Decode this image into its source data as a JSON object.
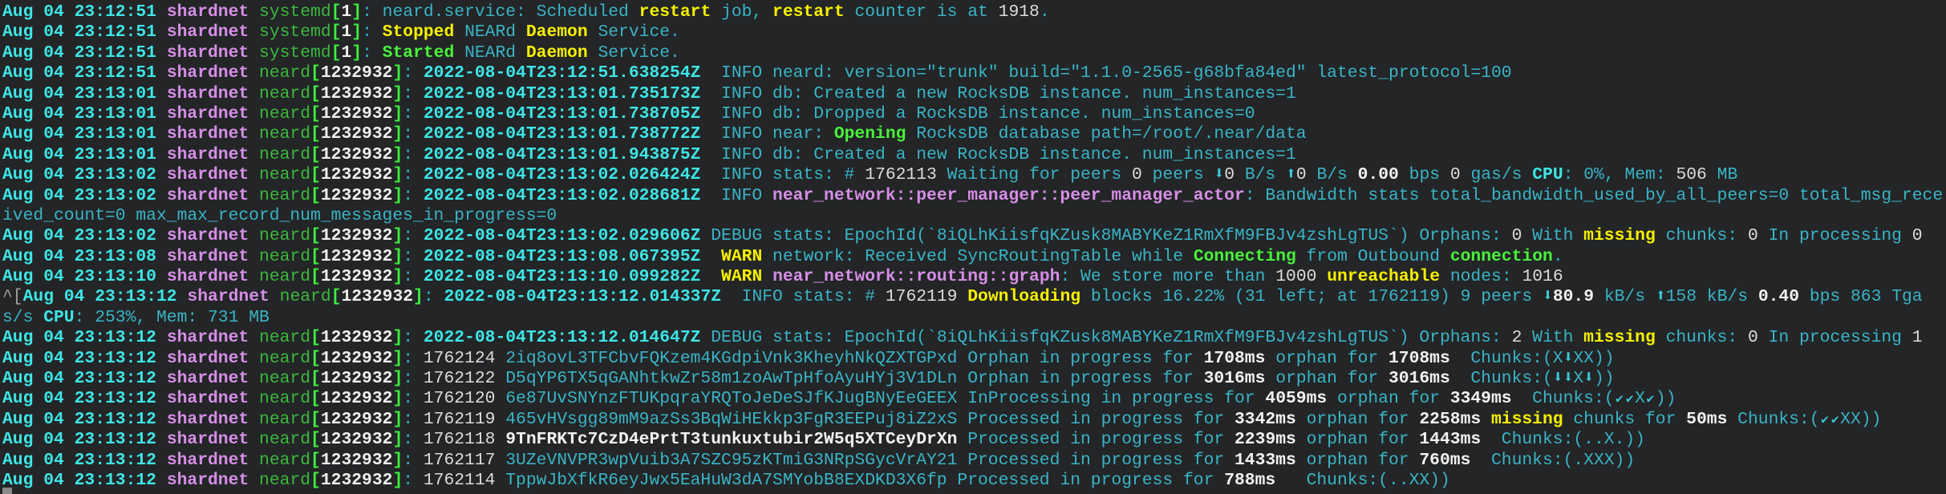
{
  "colors": {
    "background": "#232527",
    "timestamp": "#3ee6e6",
    "host": "#d68ee6",
    "text": "#3ab4c6",
    "highlight": "#f6f000",
    "success": "#4af23a"
  },
  "lines": [
    {
      "time": "Aug 04 23:12:51",
      "host": "shardnet",
      "proc": "systemd",
      "pid": "1",
      "segs": [
        [
          "neard.service: Scheduled ",
          "t"
        ],
        [
          "restart",
          "y"
        ],
        [
          " job, ",
          "t"
        ],
        [
          "restart",
          "y"
        ],
        [
          " counter is at ",
          "t"
        ],
        [
          "1918",
          "w"
        ],
        [
          ".",
          "t"
        ]
      ]
    },
    {
      "time": "Aug 04 23:12:51",
      "host": "shardnet",
      "proc": "systemd",
      "pid": "1",
      "segs": [
        [
          "Stopped",
          "y"
        ],
        [
          " NEARd ",
          "t"
        ],
        [
          "Daemon",
          "y"
        ],
        [
          " Service.",
          "t"
        ]
      ]
    },
    {
      "time": "Aug 04 23:12:51",
      "host": "shardnet",
      "proc": "systemd",
      "pid": "1",
      "segs": [
        [
          "Started",
          "g"
        ],
        [
          " NEARd ",
          "t"
        ],
        [
          "Daemon",
          "y"
        ],
        [
          " Service.",
          "t"
        ]
      ]
    },
    {
      "time": "Aug 04 23:12:51",
      "host": "shardnet",
      "proc": "neard",
      "pid": "1232932",
      "segs": [
        [
          "2022-08-04T23:12:51.638254Z",
          "c"
        ],
        [
          "  INFO neard: version=\"trunk\" build=\"1.1.0-2565-g68bfa84ed\" latest_protocol=100",
          "t"
        ]
      ]
    },
    {
      "time": "Aug 04 23:13:01",
      "host": "shardnet",
      "proc": "neard",
      "pid": "1232932",
      "segs": [
        [
          "2022-08-04T23:13:01.735173Z",
          "c"
        ],
        [
          "  INFO db: Created a new RocksDB instance. num_instances=1",
          "t"
        ]
      ]
    },
    {
      "time": "Aug 04 23:13:01",
      "host": "shardnet",
      "proc": "neard",
      "pid": "1232932",
      "segs": [
        [
          "2022-08-04T23:13:01.738705Z",
          "c"
        ],
        [
          "  INFO db: Dropped a RocksDB instance. num_instances=0",
          "t"
        ]
      ]
    },
    {
      "time": "Aug 04 23:13:01",
      "host": "shardnet",
      "proc": "neard",
      "pid": "1232932",
      "segs": [
        [
          "2022-08-04T23:13:01.738772Z",
          "c"
        ],
        [
          "  INFO near: ",
          "t"
        ],
        [
          "Opening",
          "g"
        ],
        [
          " RocksDB database path=/root/.near/data",
          "t"
        ]
      ]
    },
    {
      "time": "Aug 04 23:13:01",
      "host": "shardnet",
      "proc": "neard",
      "pid": "1232932",
      "segs": [
        [
          "2022-08-04T23:13:01.943875Z",
          "c"
        ],
        [
          "  INFO db: Created a new RocksDB instance. num_instances=1",
          "t"
        ]
      ]
    },
    {
      "time": "Aug 04 23:13:02",
      "host": "shardnet",
      "proc": "neard",
      "pid": "1232932",
      "segs": [
        [
          "2022-08-04T23:13:02.026424Z",
          "c"
        ],
        [
          "  INFO stats: # ",
          "t"
        ],
        [
          "1762113",
          "w"
        ],
        [
          " Waiting for peers ",
          "t"
        ],
        [
          "0",
          "w"
        ],
        [
          " peers ",
          "t"
        ],
        [
          "⬇",
          "a"
        ],
        [
          "0",
          "w"
        ],
        [
          " B/s ",
          "t"
        ],
        [
          "⬆",
          "a"
        ],
        [
          "0",
          "w"
        ],
        [
          " B/s ",
          "t"
        ],
        [
          "0.00",
          "W"
        ],
        [
          " bps ",
          "t"
        ],
        [
          "0",
          "w"
        ],
        [
          " gas/s ",
          "t"
        ],
        [
          "CPU",
          "c"
        ],
        [
          ": 0%, Mem: ",
          "t"
        ],
        [
          "506",
          "w"
        ],
        [
          " MB",
          "t"
        ]
      ]
    },
    {
      "time": "Aug 04 23:13:02",
      "host": "shardnet",
      "proc": "neard",
      "pid": "1232932",
      "segs": [
        [
          "2022-08-04T23:13:02.028681Z",
          "c"
        ],
        [
          "  INFO ",
          "t"
        ],
        [
          "near_network::peer_manager::peer_manager_actor",
          "v"
        ],
        [
          ": Bandwidth stats total_bandwidth_used_by_all_peers=0 total_msg_rece",
          "t"
        ]
      ]
    },
    {
      "segs": [
        [
          "ived_count=0 max_max_record_num_messages_in_progress=0",
          "t"
        ]
      ]
    },
    {
      "time": "Aug 04 23:13:02",
      "host": "shardnet",
      "proc": "neard",
      "pid": "1232932",
      "segs": [
        [
          "2022-08-04T23:13:02.029606Z",
          "c"
        ],
        [
          " DEBUG stats: EpochId(`8iQLhKiisfqKZusk8MABYKeZ1RmXfM9FBJv4zshLgTUS`) Orphans: ",
          "t"
        ],
        [
          "0",
          "w"
        ],
        [
          " With ",
          "t"
        ],
        [
          "missing",
          "y"
        ],
        [
          " chunks: ",
          "t"
        ],
        [
          "0",
          "w"
        ],
        [
          " In processing ",
          "t"
        ],
        [
          "0",
          "w"
        ]
      ]
    },
    {
      "time": "Aug 04 23:13:08",
      "host": "shardnet",
      "proc": "neard",
      "pid": "1232932",
      "segs": [
        [
          "2022-08-04T23:13:08.067395Z",
          "c"
        ],
        [
          "  ",
          "t"
        ],
        [
          "WARN",
          "y"
        ],
        [
          " network: Received SyncRoutingTable while ",
          "t"
        ],
        [
          "Connecting",
          "g"
        ],
        [
          " from Outbound ",
          "t"
        ],
        [
          "connection",
          "g"
        ],
        [
          ".",
          "t"
        ]
      ]
    },
    {
      "time": "Aug 04 23:13:10",
      "host": "shardnet",
      "proc": "neard",
      "pid": "1232932",
      "segs": [
        [
          "2022-08-04T23:13:10.099282Z",
          "c"
        ],
        [
          "  ",
          "t"
        ],
        [
          "WARN",
          "y"
        ],
        [
          " ",
          "t"
        ],
        [
          "near_network::routing::graph",
          "v"
        ],
        [
          ": We store more than ",
          "t"
        ],
        [
          "1000",
          "w"
        ],
        [
          " ",
          "t"
        ],
        [
          "unreachable",
          "y"
        ],
        [
          " nodes: ",
          "t"
        ],
        [
          "1016",
          "w"
        ]
      ]
    },
    {
      "esc": "^[",
      "time": "Aug 04 23:13:12",
      "host": "shardnet",
      "proc": "neard",
      "pid": "1232932",
      "segs": [
        [
          "2022-08-04T23:13:12.014337Z",
          "c"
        ],
        [
          "  INFO stats: # ",
          "t"
        ],
        [
          "1762119",
          "w"
        ],
        [
          " ",
          "t"
        ],
        [
          "Downloading",
          "y"
        ],
        [
          " blocks 16.22% (31 left; at 1762119) 9 peers ",
          "t"
        ],
        [
          "⬇",
          "a"
        ],
        [
          "80.9",
          "W"
        ],
        [
          " kB/s ",
          "t"
        ],
        [
          "⬆",
          "a"
        ],
        [
          "158 kB/s ",
          "t"
        ],
        [
          "0.40",
          "W"
        ],
        [
          " bps 863 Tga",
          "t"
        ]
      ]
    },
    {
      "segs": [
        [
          "s/s ",
          "t"
        ],
        [
          "CPU",
          "c"
        ],
        [
          ": 253%, Mem: 731 MB",
          "t"
        ]
      ]
    },
    {
      "time": "Aug 04 23:13:12",
      "host": "shardnet",
      "proc": "neard",
      "pid": "1232932",
      "segs": [
        [
          "2022-08-04T23:13:12.014647Z",
          "c"
        ],
        [
          " DEBUG stats: EpochId(`8iQLhKiisfqKZusk8MABYKeZ1RmXfM9FBJv4zshLgTUS`) Orphans: ",
          "t"
        ],
        [
          "2",
          "w"
        ],
        [
          " With ",
          "t"
        ],
        [
          "missing",
          "y"
        ],
        [
          " chunks: ",
          "t"
        ],
        [
          "0",
          "w"
        ],
        [
          " In processing ",
          "t"
        ],
        [
          "1",
          "w"
        ]
      ]
    },
    {
      "time": "Aug 04 23:13:12",
      "host": "shardnet",
      "proc": "neard",
      "pid": "1232932",
      "segs": [
        [
          "1762124",
          "w"
        ],
        [
          " 2iq8ovL3TFCbvFQKzem4KGdpiVnk3KheyhNkQZXTGPxd Orphan in progress for ",
          "t"
        ],
        [
          "1708ms",
          "W"
        ],
        [
          " orphan for ",
          "t"
        ],
        [
          "1708ms",
          "W"
        ],
        [
          "  Chunks:(X",
          "t"
        ],
        [
          "⬇",
          "a"
        ],
        [
          "XX))",
          "t"
        ]
      ]
    },
    {
      "time": "Aug 04 23:13:12",
      "host": "shardnet",
      "proc": "neard",
      "pid": "1232932",
      "segs": [
        [
          "1762122",
          "w"
        ],
        [
          " D5qYP6TX5qGANhtkwZr58m1zoAwTpHfoAyuHYj3V1DLn Orphan in progress for ",
          "t"
        ],
        [
          "3016ms",
          "W"
        ],
        [
          " orphan for ",
          "t"
        ],
        [
          "3016ms",
          "W"
        ],
        [
          "  Chunks:(",
          "t"
        ],
        [
          "⬇",
          "a"
        ],
        [
          "⬇",
          "a"
        ],
        [
          "X",
          "t"
        ],
        [
          "⬇",
          "a"
        ],
        [
          "))",
          "t"
        ]
      ]
    },
    {
      "time": "Aug 04 23:13:12",
      "host": "shardnet",
      "proc": "neard",
      "pid": "1232932",
      "segs": [
        [
          "1762120",
          "w"
        ],
        [
          " 6e87UvSNYnzFTUKpqraYRQToJeDeSJfKJugBNyEeGEEX InProcessing in progress for ",
          "t"
        ],
        [
          "4059ms",
          "W"
        ],
        [
          " orphan for ",
          "t"
        ],
        [
          "3349ms",
          "W"
        ],
        [
          "  Chunks:(",
          "t"
        ],
        [
          "✔",
          "ck"
        ],
        [
          "✔",
          "ck"
        ],
        [
          "X",
          "t"
        ],
        [
          "✔",
          "ck"
        ],
        [
          "))",
          "t"
        ]
      ]
    },
    {
      "time": "Aug 04 23:13:12",
      "host": "shardnet",
      "proc": "neard",
      "pid": "1232932",
      "segs": [
        [
          "1762119",
          "w"
        ],
        [
          " 465vHVsgg89mM9azSs3BqWiHEkkp3FgR3EEPuj8iZ2xS Processed in progress for ",
          "t"
        ],
        [
          "3342ms",
          "W"
        ],
        [
          " orphan for ",
          "t"
        ],
        [
          "2258ms",
          "W"
        ],
        [
          " ",
          "t"
        ],
        [
          "missing",
          "y"
        ],
        [
          " chunks for ",
          "t"
        ],
        [
          "50ms",
          "W"
        ],
        [
          " Chunks:(",
          "t"
        ],
        [
          "✔",
          "ck"
        ],
        [
          "✔",
          "ck"
        ],
        [
          "XX))",
          "t"
        ]
      ]
    },
    {
      "time": "Aug 04 23:13:12",
      "host": "shardnet",
      "proc": "neard",
      "pid": "1232932",
      "segs": [
        [
          "1762118",
          "w"
        ],
        [
          " ",
          "t"
        ],
        [
          "9TnFRKTc7CzD4ePrtT3tunkuxtubir2W5q5XTCeyDrXn",
          "W"
        ],
        [
          " Processed in progress for ",
          "t"
        ],
        [
          "2239ms",
          "W"
        ],
        [
          " orphan for ",
          "t"
        ],
        [
          "1443ms",
          "W"
        ],
        [
          "  Chunks:(..X.))",
          "t"
        ]
      ]
    },
    {
      "time": "Aug 04 23:13:12",
      "host": "shardnet",
      "proc": "neard",
      "pid": "1232932",
      "segs": [
        [
          "1762117",
          "w"
        ],
        [
          " 3UZeVNVPR3wpVuib3A7SZC95zKTmiG3NRpSGycVrAY21 Processed in progress for ",
          "t"
        ],
        [
          "1433ms",
          "W"
        ],
        [
          " orphan for ",
          "t"
        ],
        [
          "760ms",
          "W"
        ],
        [
          "  Chunks:(.XXX))",
          "t"
        ]
      ]
    },
    {
      "time": "Aug 04 23:13:12",
      "host": "shardnet",
      "proc": "neard",
      "pid": "1232932",
      "segs": [
        [
          "1762114",
          "w"
        ],
        [
          " TppwJbXfkR6eyJwx5EaHuW3dA7SMYobB8EXDKD3X6fp Processed in progress for ",
          "t"
        ],
        [
          "788ms",
          "W"
        ],
        [
          "   Chunks:(..XX))",
          "t"
        ]
      ]
    }
  ]
}
